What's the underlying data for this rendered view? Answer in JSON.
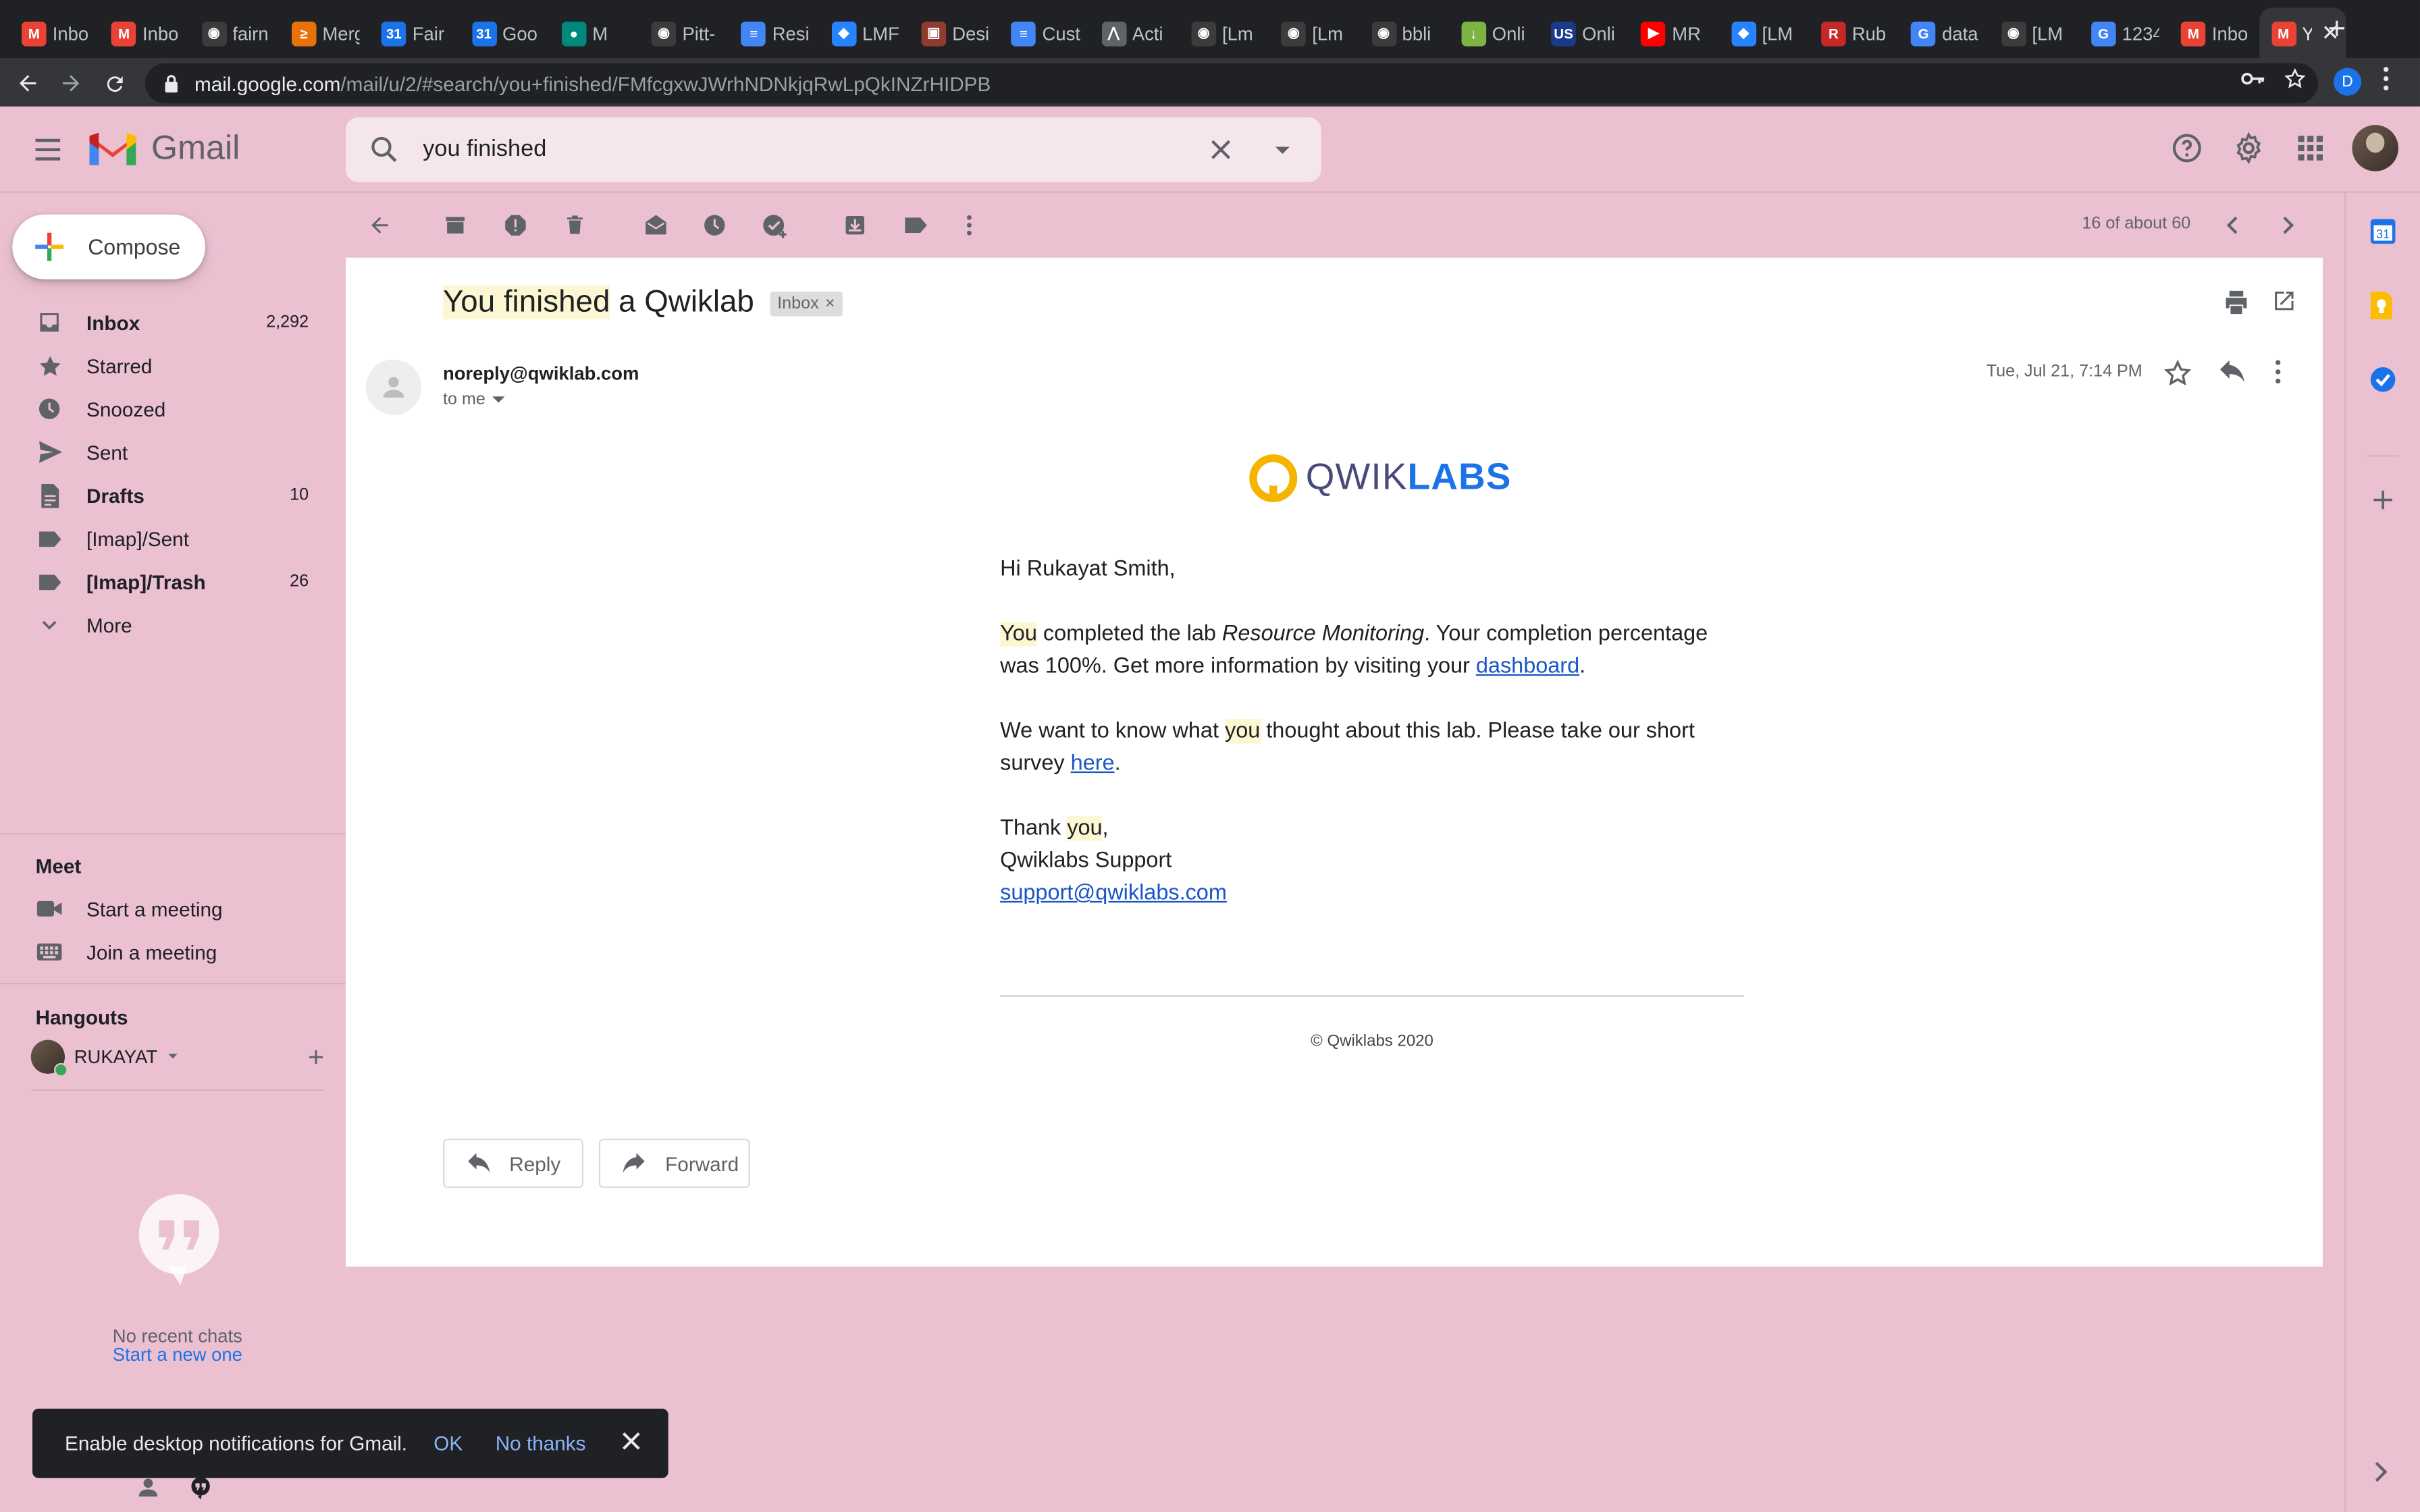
{
  "browser": {
    "tabs": [
      {
        "label": "Inbo",
        "fav": "gmail-icon"
      },
      {
        "label": "Inbo",
        "fav": "gmail-icon"
      },
      {
        "label": "fairn",
        "fav": "github-icon"
      },
      {
        "label": "Merg",
        "fav": "merge-icon"
      },
      {
        "label": "Fair",
        "fav": "calendar-icon"
      },
      {
        "label": "Goo",
        "fav": "calendar-icon"
      },
      {
        "label": "M",
        "fav": "meet-icon"
      },
      {
        "label": "Pitt-",
        "fav": "github-icon"
      },
      {
        "label": "Resi",
        "fav": "docs-icon"
      },
      {
        "label": "LMF",
        "fav": "jira-icon"
      },
      {
        "label": "Desi",
        "fav": "design-icon"
      },
      {
        "label": "Cust",
        "fav": "docs-icon"
      },
      {
        "label": "Acti",
        "fav": "activity-icon"
      },
      {
        "label": "[Lm",
        "fav": "github-icon"
      },
      {
        "label": "[Lm",
        "fav": "github-icon"
      },
      {
        "label": "bbli",
        "fav": "github-icon"
      },
      {
        "label": "Onli",
        "fav": "download-icon"
      },
      {
        "label": "Onli",
        "fav": "us-icon"
      },
      {
        "label": "MR",
        "fav": "youtube-icon"
      },
      {
        "label": "[LM",
        "fav": "jira-icon"
      },
      {
        "label": "Rub",
        "fav": "r-icon"
      },
      {
        "label": "data",
        "fav": "google-icon"
      },
      {
        "label": "[LM",
        "fav": "github-icon"
      },
      {
        "label": "1234",
        "fav": "google-icon"
      },
      {
        "label": "Inbo",
        "fav": "gmail-icon"
      },
      {
        "label": "Y",
        "fav": "gmail-icon"
      }
    ],
    "url_host": "mail.google.com",
    "url_path": "/mail/u/2/#search/you+finished/FMfcgxwJWrhNDNkjqRwLpQkINZrHIDPB",
    "profile_initial": "D"
  },
  "gmail": {
    "brand": "Gmail",
    "search_value": "you finished"
  },
  "sidebar": {
    "compose_label": "Compose",
    "items": [
      {
        "label": "Inbox",
        "count": "2,292",
        "icon": "inbox-icon",
        "bold": true
      },
      {
        "label": "Starred",
        "count": "",
        "icon": "star-icon",
        "bold": false
      },
      {
        "label": "Snoozed",
        "count": "",
        "icon": "clock-icon",
        "bold": false
      },
      {
        "label": "Sent",
        "count": "",
        "icon": "send-icon",
        "bold": false
      },
      {
        "label": "Drafts",
        "count": "10",
        "icon": "draft-icon",
        "bold": true
      },
      {
        "label": "[Imap]/Sent",
        "count": "",
        "icon": "label-icon",
        "bold": false
      },
      {
        "label": "[Imap]/Trash",
        "count": "26",
        "icon": "label-icon",
        "bold": true
      },
      {
        "label": "More",
        "count": "",
        "icon": "chevron-down-icon",
        "bold": false
      }
    ],
    "meet_heading": "Meet",
    "meet_start": "Start a meeting",
    "meet_join": "Join a meeting",
    "hangouts_heading": "Hangouts",
    "hangouts_user": "RUKAYAT",
    "no_chats": "No recent chats",
    "start_new": "Start a new one"
  },
  "toolbar": {
    "pager": "16 of about 60"
  },
  "email": {
    "subject_part1": "You finished",
    "subject_part2": " a Qwiklab",
    "label_chip": "Inbox",
    "sender": "noreply@qwiklab.com",
    "to": "to me",
    "date": "Tue, Jul 21, 7:14 PM",
    "logo_word1": "QWIK",
    "logo_word2": "LABS",
    "greeting": "Hi Rukayat Smith,",
    "p1_you": "You",
    "p1_a": " completed the lab ",
    "p1_lab": "Resource Monitoring",
    "p1_b": ". Your completion percentage was 100%. Get more information by visiting your ",
    "p1_link": "dashboard",
    "p1_end": ".",
    "p2_a": "We want to know what ",
    "p2_you": "you",
    "p2_b": " thought about this lab. Please take our short survey ",
    "p2_link": "here",
    "p2_end": ".",
    "thanks_a": "Thank ",
    "thanks_you": "you",
    "thanks_end": ",",
    "signature": "Qwiklabs Support",
    "support_email": "support@qwiklabs.com",
    "copyright": "© Qwiklabs 2020",
    "reply_label": "Reply",
    "forward_label": "Forward"
  },
  "snackbar": {
    "text": "Enable desktop notifications for Gmail.",
    "ok": "OK",
    "no_thanks": "No thanks"
  },
  "colors": {
    "background": "#ebc0d1",
    "accent": "#1a73e8",
    "highlight": "#fcf7d2"
  }
}
